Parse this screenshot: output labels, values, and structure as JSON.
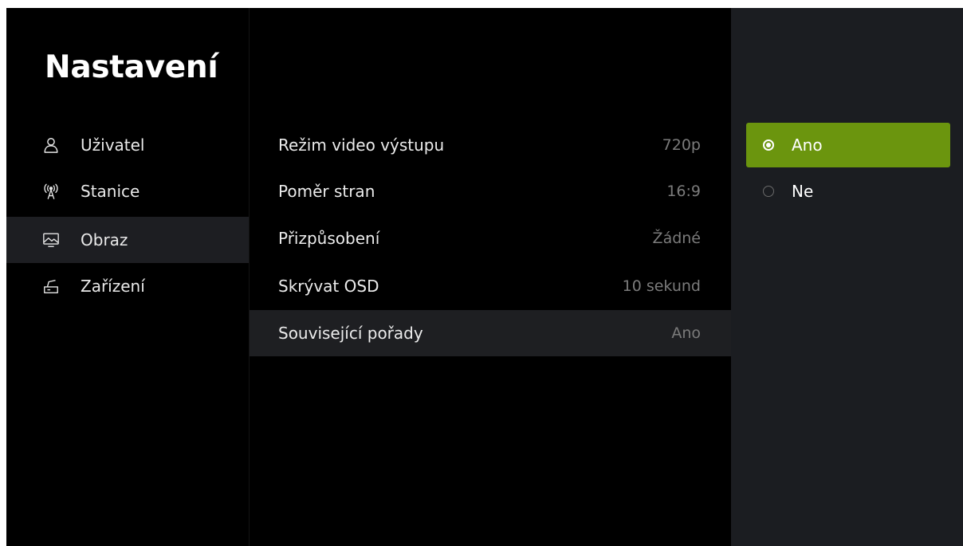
{
  "sidebar": {
    "title": "Nastavení",
    "items": [
      {
        "label": "Uživatel",
        "icon": "user-icon"
      },
      {
        "label": "Stanice",
        "icon": "antenna-icon"
      },
      {
        "label": "Obraz",
        "icon": "picture-icon",
        "active": true
      },
      {
        "label": "Zařízení",
        "icon": "device-icon"
      }
    ]
  },
  "settings": {
    "rows": [
      {
        "label": "Režim video výstupu",
        "value": "720p"
      },
      {
        "label": "Poměr stran",
        "value": "16:9"
      },
      {
        "label": "Přizpůsobení",
        "value": "Žádné"
      },
      {
        "label": "Skrývat OSD",
        "value": "10 sekund"
      },
      {
        "label": "Související pořady",
        "value": "Ano",
        "active": true
      }
    ]
  },
  "options": {
    "items": [
      {
        "label": "Ano",
        "selected": true
      },
      {
        "label": "Ne",
        "selected": false
      }
    ]
  },
  "colors": {
    "accent": "#6b950e",
    "background": "#000000",
    "active_row": "#1e1f22",
    "options_panel": "#1b1d21",
    "value_text": "#7b7b7b"
  }
}
